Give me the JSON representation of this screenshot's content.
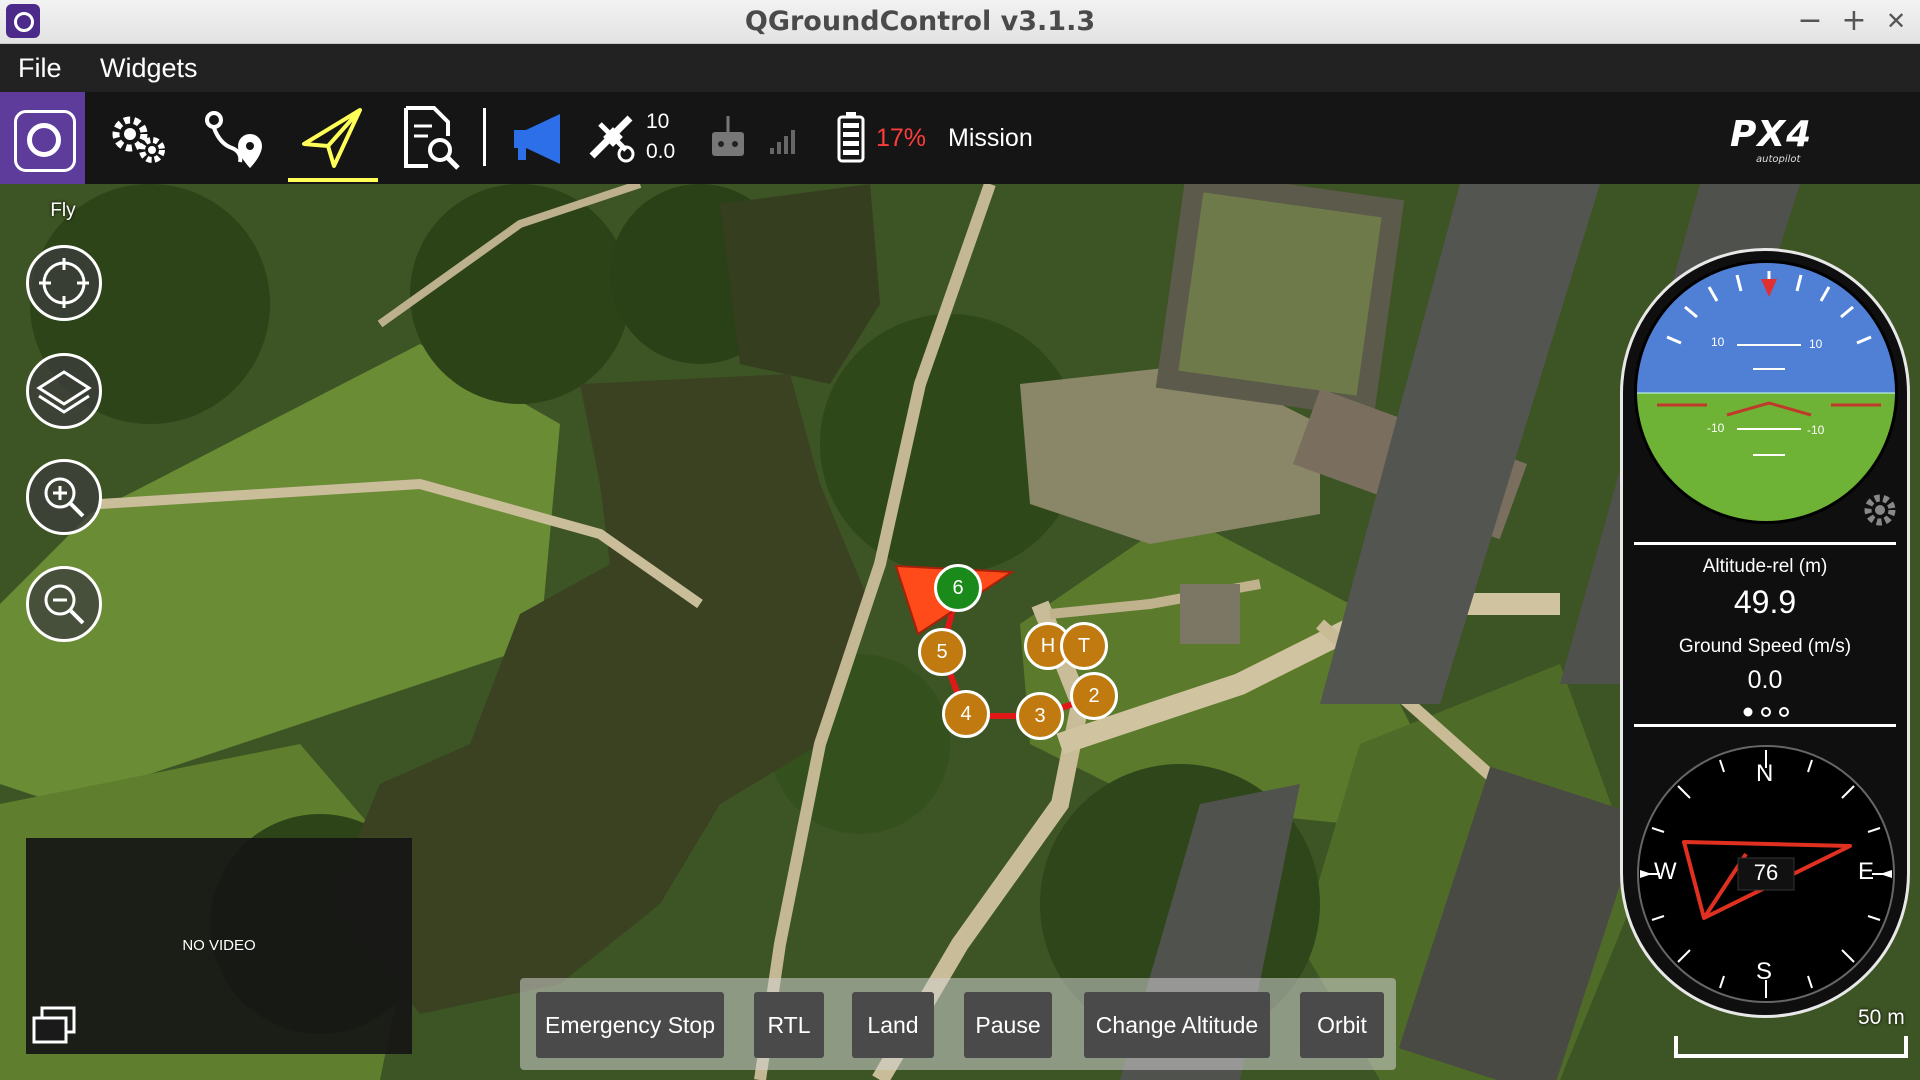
{
  "window": {
    "title": "QGroundControl v3.1.3",
    "controls": {
      "minimize": "−",
      "maximize": "+",
      "close": "✕"
    }
  },
  "menu": {
    "items": [
      {
        "label": "File"
      },
      {
        "label": "Widgets"
      }
    ]
  },
  "toolbar": {
    "buttons": [
      "qgc-logo",
      "settings-icon",
      "plan-icon",
      "fly-icon",
      "analyze-icon"
    ],
    "active_view": "fly",
    "gps": {
      "satellites": "10",
      "hdop": "0.0"
    },
    "battery_percent": "17%",
    "flight_mode": "Mission",
    "brand": {
      "logo": "PX4",
      "sub": "autopilot"
    }
  },
  "map": {
    "mission_items": [
      {
        "label": "6",
        "kind": "current"
      },
      {
        "label": "5",
        "kind": "waypoint"
      },
      {
        "label": "4",
        "kind": "waypoint"
      },
      {
        "label": "3",
        "kind": "waypoint"
      },
      {
        "label": "2",
        "kind": "waypoint"
      },
      {
        "label": "H",
        "kind": "home"
      },
      {
        "label": "T",
        "kind": "takeoff"
      }
    ],
    "scale_label": "50 m"
  },
  "fly_tools": {
    "label": "Fly",
    "buttons": [
      "center-icon",
      "map-layers-icon",
      "zoom-in-icon",
      "zoom-out-icon"
    ]
  },
  "video": {
    "status": "NO VIDEO"
  },
  "actions": {
    "emergency_stop": "Emergency Stop",
    "rtl": "RTL",
    "land": "Land",
    "pause": "Pause",
    "change_altitude": "Change Altitude",
    "orbit": "Orbit"
  },
  "instruments": {
    "attitude": {
      "pitch_ticks": [
        "10",
        "10",
        "-10",
        "-10"
      ]
    },
    "values": [
      {
        "label": "Altitude-rel (m)",
        "value": "49.9"
      },
      {
        "label": "Ground Speed (m/s)",
        "value": "0.0"
      }
    ],
    "compass": {
      "heading": "76",
      "cardinals": {
        "n": "N",
        "e": "E",
        "s": "S",
        "w": "W"
      }
    }
  },
  "colors": {
    "accent_active": "#ffff57",
    "waypoint": "#c07a10",
    "current_waypoint": "#1a8a1a",
    "vehicle": "#ff4a1a",
    "battery_low": "#ff3c3c",
    "sky": "#4f80d6",
    "ground": "#6eb335"
  }
}
